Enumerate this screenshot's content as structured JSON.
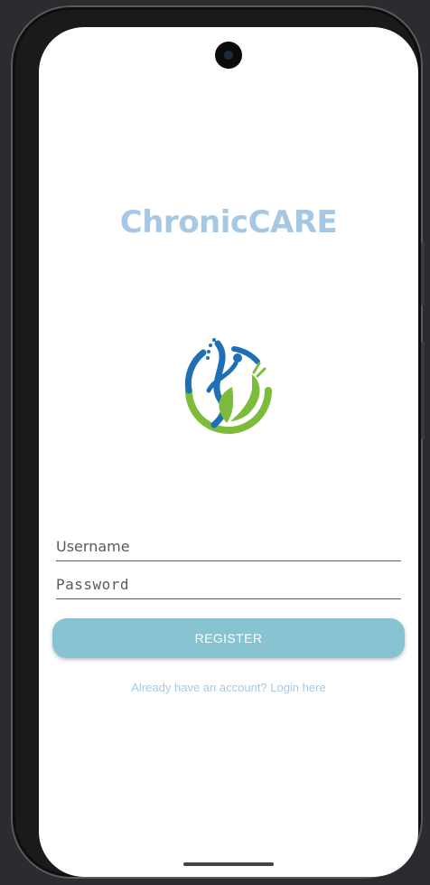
{
  "app": {
    "title": "ChronicCARE",
    "logo_icon": "spine-figure-with-caring-hands-logo",
    "title_color": "#a7c8e4",
    "logo_colors": {
      "blue": "#1f6fb5",
      "green": "#7cbc3a"
    }
  },
  "form": {
    "username": {
      "value": "",
      "placeholder": "Username"
    },
    "password": {
      "value": "",
      "placeholder": "Password"
    }
  },
  "actions": {
    "register_label": "REGISTER",
    "register_color": "#87c3d1",
    "login_link_text": "Already have an account? Login here"
  }
}
